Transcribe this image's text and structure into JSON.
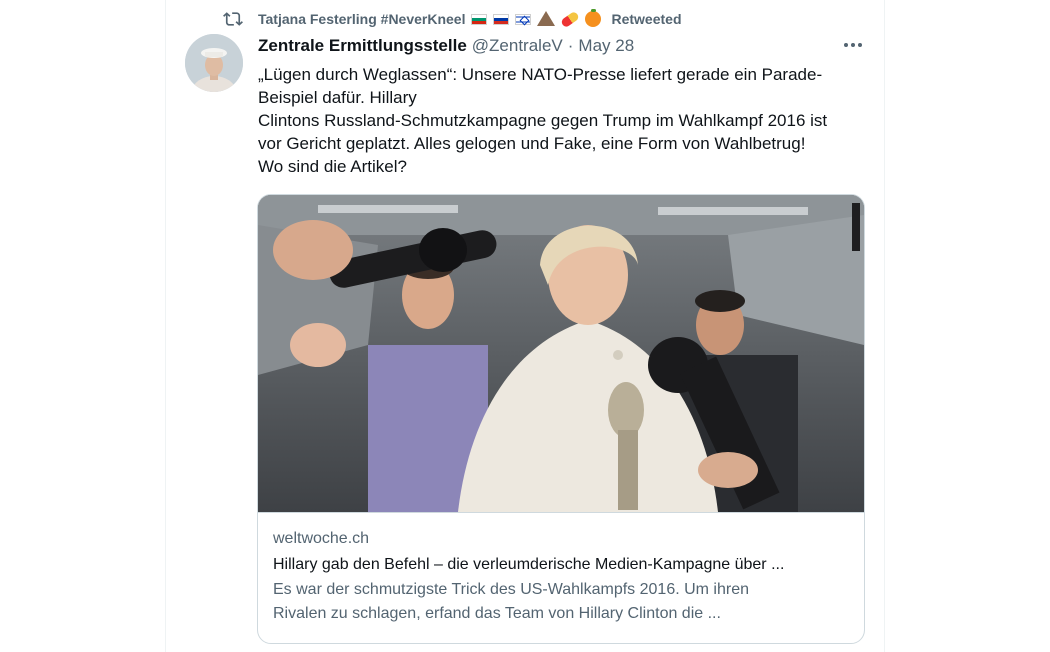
{
  "retweet": {
    "retweeter": "Tatjana Festerling #NeverKneel",
    "emoji": [
      "flag-bulgaria",
      "flag-russia",
      "flag-israel",
      "volcano",
      "pill",
      "tangerine"
    ],
    "label": "Retweeted",
    "icon": "retweet-icon"
  },
  "tweet": {
    "display_name": "Zentrale Ermittlungsstelle",
    "handle": "@ZentraleV",
    "separator": "·",
    "date": "May 28",
    "more_icon": "more-icon",
    "text_lines": [
      "„Lügen durch Weglassen“: Unsere NATO-Presse liefert gerade ein Parade-",
      "Beispiel dafür. Hillary",
      "Clintons Russland-Schmutzkampagne gegen Trump im Wahlkampf 2016 ist",
      "vor Gericht geplatzt. Alles gelogen und Fake, eine Form von Wahlbetrug!",
      "Wo sind die Artikel?"
    ]
  },
  "card": {
    "domain": "weltwoche.ch",
    "title": "Hillary gab den Befehl – die verleumderische Medien-Kampagne über ...",
    "description_lines": [
      "Es war der schmutzigste Trick des US-Wahlkampfs 2016. Um ihren",
      "Rivalen zu schlagen, erfand das Team von Hillary Clinton die ..."
    ]
  },
  "colors": {
    "text_primary": "#0f1419",
    "text_secondary": "#536471",
    "border": "#cfd9de"
  }
}
